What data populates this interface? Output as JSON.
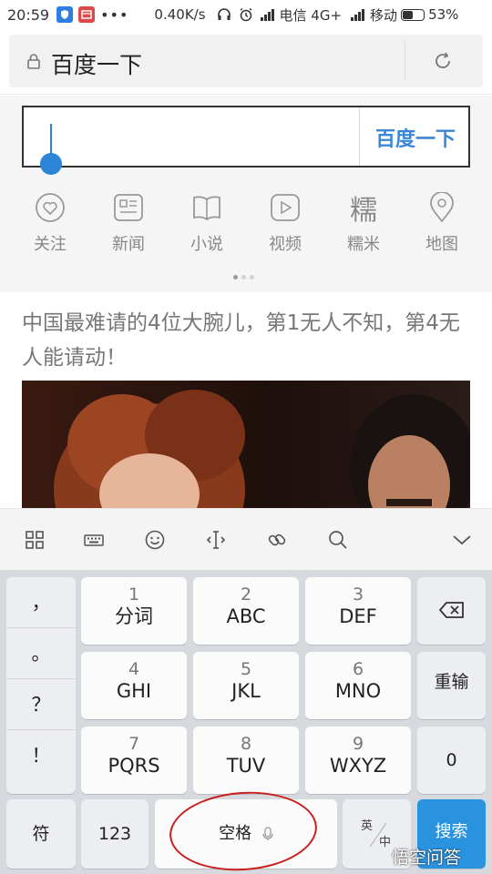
{
  "status_bar": {
    "time": "20:59",
    "dots": "•••",
    "speed": "0.40K/s",
    "carrier1": "电信 4G+",
    "carrier2": "移动",
    "battery": "53%",
    "battery_level": 0.53
  },
  "url_bar": {
    "title": "百度一下"
  },
  "search": {
    "button_label": "百度一下"
  },
  "quick_links": [
    {
      "label": "关注",
      "icon": "heart-icon"
    },
    {
      "label": "新闻",
      "icon": "news-icon"
    },
    {
      "label": "小说",
      "icon": "book-icon"
    },
    {
      "label": "视频",
      "icon": "play-icon"
    },
    {
      "label": "糯米",
      "icon": "nuomi-icon",
      "glyph": "糯"
    },
    {
      "label": "地图",
      "icon": "map-pin-icon"
    }
  ],
  "article": {
    "headline": "中国最难请的4位大腕儿，第1无人不知，第4无人能请动！"
  },
  "keyboard": {
    "punctuation": [
      "，",
      "。",
      "？",
      "！"
    ],
    "keys": [
      {
        "num": "1",
        "label": "分词"
      },
      {
        "num": "2",
        "label": "ABC"
      },
      {
        "num": "3",
        "label": "DEF"
      },
      {
        "num": "4",
        "label": "GHI"
      },
      {
        "num": "5",
        "label": "JKL"
      },
      {
        "num": "6",
        "label": "MNO"
      },
      {
        "num": "7",
        "label": "PQRS"
      },
      {
        "num": "8",
        "label": "TUV"
      },
      {
        "num": "9",
        "label": "WXYZ"
      }
    ],
    "reenter": "重输",
    "zero": "0",
    "symbol": "符",
    "num_mode": "123",
    "space": "空格",
    "lang_en": "英",
    "lang_zh": "中",
    "search": "搜索"
  },
  "watermark": "悟空问答",
  "colors": {
    "accent": "#2c85d7",
    "search_key": "#2a93e0",
    "annotation_circle": "#c91f1f"
  }
}
